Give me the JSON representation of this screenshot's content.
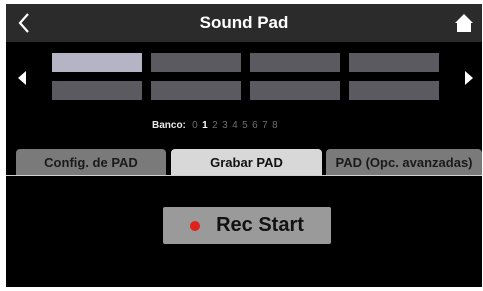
{
  "header": {
    "title": "Sound Pad",
    "back_icon": "chevron-left-icon",
    "home_icon": "home-icon"
  },
  "pads": {
    "selected_index": 0,
    "count": 8
  },
  "bank": {
    "label": "Banco:",
    "numbers": [
      "0",
      "1",
      "2",
      "3",
      "4",
      "5",
      "6",
      "7",
      "8"
    ],
    "active": "1"
  },
  "tabs": [
    {
      "label": "Config. de PAD",
      "active": false
    },
    {
      "label": "Grabar PAD",
      "active": true
    },
    {
      "label": "PAD (Opc. avanzadas)",
      "active": false
    }
  ],
  "rec": {
    "label": "Rec Start",
    "dot_color": "#e0211c"
  },
  "colors": {
    "header_bg": "#2b2b2b",
    "pad": "#5a5a60",
    "pad_selected": "#b4b4c4",
    "tab_active": "#d8d8d8",
    "tab_inactive": "#7a7a7a",
    "rec_button": "#9a9a9a"
  }
}
